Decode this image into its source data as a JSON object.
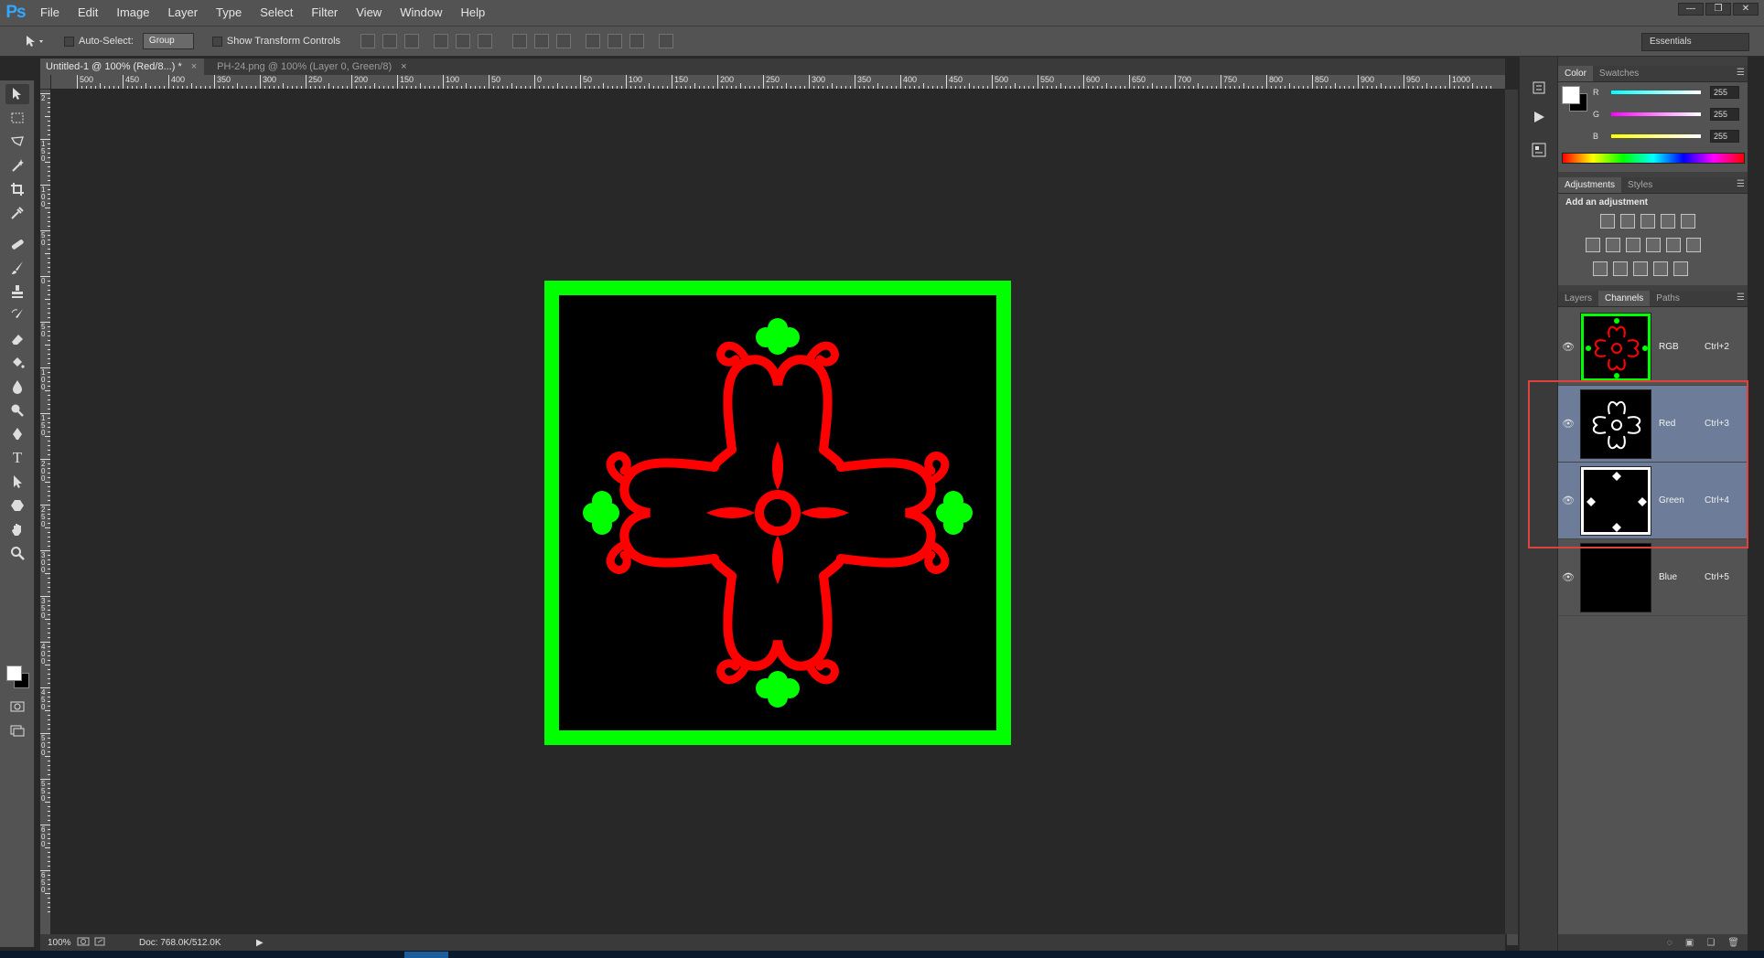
{
  "app": {
    "logo": "Ps"
  },
  "menu": [
    "File",
    "Edit",
    "Image",
    "Layer",
    "Type",
    "Select",
    "Filter",
    "View",
    "Window",
    "Help"
  ],
  "window_controls": {
    "minimize": "—",
    "restore": "❐",
    "close": "✕"
  },
  "options": {
    "auto_select_label": "Auto-Select:",
    "auto_select_value": "Group",
    "transform_controls_label": "Show Transform Controls",
    "workspace": "Essentials"
  },
  "tabs": [
    {
      "label": "Untitled-1 @ 100% (Red/8...) *",
      "close": "×"
    },
    {
      "label": "PH-24.png @ 100% (Layer 0, Green/8)",
      "close": "×"
    }
  ],
  "ruler_top": [
    "500",
    "450",
    "400",
    "350",
    "300",
    "250",
    "200",
    "150",
    "100",
    "50",
    "0",
    "50",
    "100",
    "150",
    "200",
    "250",
    "300",
    "350",
    "400",
    "450",
    "500",
    "550",
    "600",
    "650",
    "700",
    "750",
    "800",
    "850",
    "900",
    "950",
    "1000"
  ],
  "ruler_left": [
    "2",
    "1 5 0",
    "1 0 0",
    "5 0",
    "0",
    "5 0",
    "1 0 0",
    "1 5 0",
    "2 0 0",
    "2 5 0",
    "3 0 0",
    "3 5 0",
    "4 0 0",
    "4 5 0",
    "5 0 0",
    "5 5 0",
    "6 0 0",
    "6 5 0"
  ],
  "status": {
    "zoom": "100%",
    "doc": "Doc: 768.0K/512.0K",
    "arrow": "▶"
  },
  "color_panel": {
    "tabs": [
      "Color",
      "Swatches"
    ],
    "channels": [
      {
        "label": "R",
        "value": "255",
        "color": "#00ffff"
      },
      {
        "label": "G",
        "value": "255",
        "color": "#ff00ff"
      },
      {
        "label": "B",
        "value": "255",
        "color": "#ffff00"
      }
    ]
  },
  "adjustments_panel": {
    "tabs": [
      "Adjustments",
      "Styles"
    ],
    "title": "Add an adjustment"
  },
  "channels_panel": {
    "tabs": [
      "Layers",
      "Channels",
      "Paths"
    ],
    "rows": [
      {
        "name": "RGB",
        "shortcut": "Ctrl+2",
        "selected": false
      },
      {
        "name": "Red",
        "shortcut": "Ctrl+3",
        "selected": true
      },
      {
        "name": "Green",
        "shortcut": "Ctrl+4",
        "selected": true
      },
      {
        "name": "Blue",
        "shortcut": "Ctrl+5",
        "selected": false
      }
    ]
  },
  "colors": {
    "accent_green": "#00ff00",
    "accent_red": "#ff0000",
    "selection": "#6d7d99",
    "highlight": "#e04040"
  },
  "icons": [
    "move-icon",
    "marquee-icon",
    "lasso-icon",
    "magic-wand-icon",
    "crop-icon",
    "eyedropper-icon",
    "healing-icon",
    "brush-icon",
    "stamp-icon",
    "history-brush-icon",
    "eraser-icon",
    "bucket-icon",
    "blur-icon",
    "dodge-icon",
    "pen-icon",
    "type-icon",
    "path-select-icon",
    "shape-icon",
    "hand-icon",
    "zoom-icon"
  ]
}
